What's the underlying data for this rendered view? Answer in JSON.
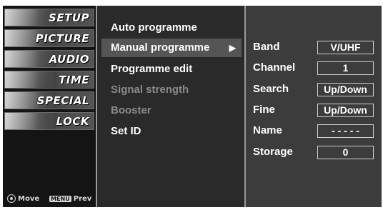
{
  "categories": [
    {
      "label": "SETUP",
      "icon": "tv-setup-icon",
      "active": false
    },
    {
      "label": "PICTURE",
      "icon": "picture-icon",
      "active": false
    },
    {
      "label": "AUDIO",
      "icon": "audio-icon",
      "active": false
    },
    {
      "label": "TIME",
      "icon": "clock-icon",
      "active": false
    },
    {
      "label": "SPECIAL",
      "icon": "special-icon",
      "active": false
    },
    {
      "label": "LOCK",
      "icon": "lock-icon",
      "active": false
    }
  ],
  "hint": {
    "move": "Move",
    "menu_key": "MENU",
    "prev": "Prev"
  },
  "menu": {
    "items": [
      {
        "label": "Auto programme",
        "state": "normal"
      },
      {
        "label": "Manual programme",
        "state": "selected",
        "arrow": "▶"
      },
      {
        "label": "Programme edit",
        "state": "normal"
      },
      {
        "label": "Signal strength",
        "state": "disabled"
      },
      {
        "label": "Booster",
        "state": "disabled"
      },
      {
        "label": "Set ID",
        "state": "normal"
      }
    ]
  },
  "submenu": {
    "rows": [
      {
        "key": "Band",
        "value": "V/UHF"
      },
      {
        "key": "Channel",
        "value": "1"
      },
      {
        "key": "Search",
        "value": "Up/Down"
      },
      {
        "key": "Fine",
        "value": "Up/Down"
      },
      {
        "key": "Name",
        "value": "- - - - -"
      },
      {
        "key": "Storage",
        "value": "0"
      }
    ]
  }
}
